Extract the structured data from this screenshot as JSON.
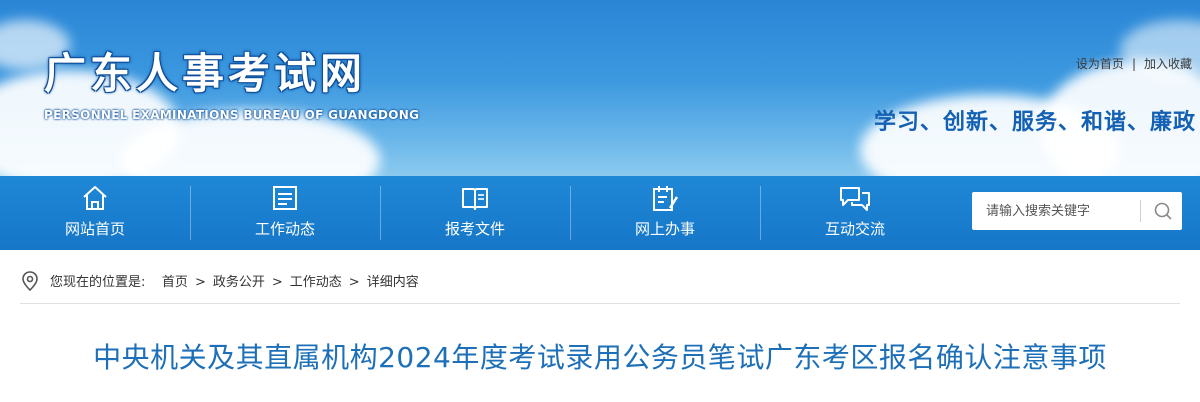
{
  "header": {
    "site_title": "广东人事考试网",
    "site_subtitle": "PERSONNEL EXAMINATIONS BUREAU OF GUANGDONG",
    "top_links": [
      "设为首页",
      "加入收藏"
    ],
    "top_links_separator": "|",
    "slogan": "学习、创新、服务、和谐、廉政"
  },
  "nav": {
    "items": [
      {
        "label": "网站首页",
        "icon": "home-icon"
      },
      {
        "label": "工作动态",
        "icon": "news-icon"
      },
      {
        "label": "报考文件",
        "icon": "book-icon"
      },
      {
        "label": "网上办事",
        "icon": "edit-document-icon"
      },
      {
        "label": "互动交流",
        "icon": "chat-icon"
      }
    ],
    "search": {
      "placeholder": "请输入搜索关键字",
      "icon": "search-icon"
    }
  },
  "breadcrumb": {
    "prefix": "您现在的位置是:",
    "items": [
      "首页",
      "政务公开",
      "工作动态",
      "详细内容"
    ],
    "separator": ">",
    "icon": "location-pin-icon"
  },
  "article": {
    "title": "中央机关及其直属机构2024年度考试录用公务员笔试广东考区报名确认注意事项"
  },
  "colors": {
    "nav_bg": "#1a7fcf",
    "title_text": "#1d6fb8",
    "slogan_text": "#1461b4",
    "banner_sky": "#3c98df"
  }
}
